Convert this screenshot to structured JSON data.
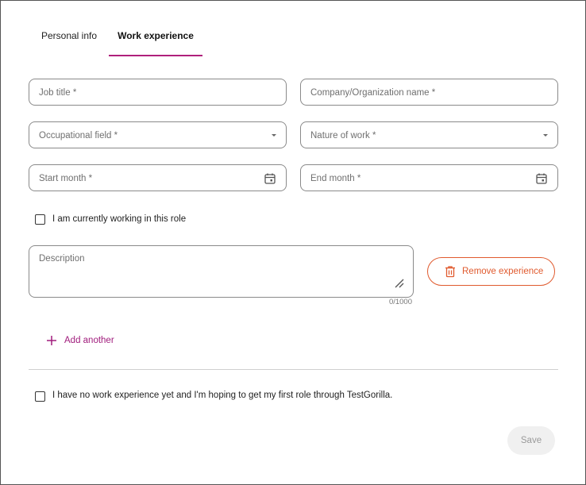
{
  "tabs": [
    {
      "label": "Personal info"
    },
    {
      "label": "Work experience"
    }
  ],
  "fields": {
    "job_title": {
      "label": "Job title *",
      "value": ""
    },
    "company": {
      "label": "Company/Organization name *",
      "value": ""
    },
    "occupational_field": {
      "label": "Occupational field *",
      "value": ""
    },
    "nature_of_work": {
      "label": "Nature of work *",
      "value": ""
    },
    "start_month": {
      "label": "Start month *",
      "value": ""
    },
    "end_month": {
      "label": "End month *",
      "value": ""
    },
    "description": {
      "label": "Description",
      "value": ""
    }
  },
  "currently_working": {
    "label": "I am currently working in this role",
    "checked": false
  },
  "description_counter": "0/1000",
  "remove_experience": "Remove experience",
  "add_another": "Add another",
  "no_experience": {
    "label": "I have no work experience yet and I'm hoping to get my first role through TestGorilla.",
    "checked": false
  },
  "save": "Save",
  "colors": {
    "accent": "#a01c7c",
    "danger": "#e05a2e",
    "border": "#8a8a8a"
  }
}
